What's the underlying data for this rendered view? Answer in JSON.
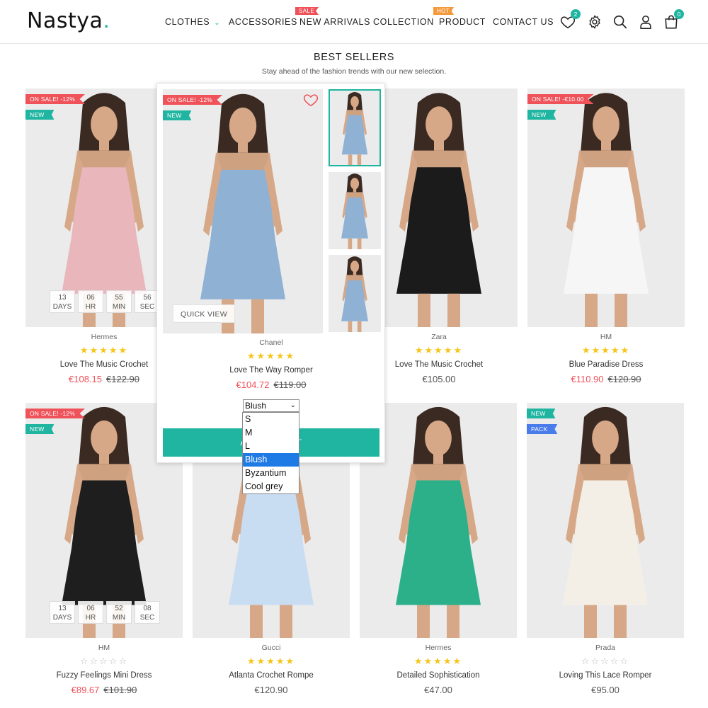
{
  "header": {
    "logo": "Nastya",
    "logo_dot": ".",
    "nav": [
      {
        "label": "CLOTHES",
        "has_chevron": true
      },
      {
        "label": "ACCESSORIES"
      },
      {
        "label": "NEW ARRIVALS",
        "badge": "SALE"
      },
      {
        "label": "COLLECTION"
      },
      {
        "label": "PRODUCT",
        "badge": "HOT"
      },
      {
        "label": "CONTACT US"
      }
    ],
    "wishlist_count": "2",
    "cart_count": "0",
    "icons": [
      "heart-icon",
      "gear-icon",
      "search-icon",
      "user-icon",
      "shopping-bag-icon"
    ]
  },
  "section": {
    "title": "BEST SELLERS",
    "subtitle": "Stay ahead of the fashion trends with our new selection."
  },
  "countdown_units": [
    "DAYS",
    "HR",
    "MIN",
    "SEC"
  ],
  "products": [
    {
      "brand": "Hermes",
      "name": "Love The Music Crochet",
      "price": "€108.15",
      "old_price": "€122.90",
      "rating": 5,
      "badges": [
        "ON SALE! -12%",
        "NEW"
      ],
      "countdown": [
        "13",
        "06",
        "55",
        "56"
      ],
      "color": "#e9b6bb"
    },
    {
      "brand": "Zara",
      "name": "Love The Music Crochet",
      "price": "€105.00",
      "old_price": "",
      "rating": 5,
      "badges": [],
      "color": "#1b1b1b"
    },
    {
      "brand": "HM",
      "name": "Blue Paradise Dress",
      "price": "€110.90",
      "old_price": "€120.90",
      "rating": 5,
      "badges": [
        "ON SALE! -€10.00",
        "NEW"
      ],
      "color": "#f6f6f6"
    },
    {
      "brand": "HM",
      "name": "Fuzzy Feelings Mini Dress",
      "price": "€89.67",
      "old_price": "€101.90",
      "rating": 0,
      "badges": [
        "ON SALE! -12%",
        "NEW"
      ],
      "countdown": [
        "13",
        "06",
        "52",
        "08"
      ],
      "color": "#1e1e1e"
    },
    {
      "brand": "Gucci",
      "name": "Atlanta Crochet Rompe",
      "price": "€120.90",
      "old_price": "",
      "rating": 5,
      "badges": [],
      "color": "#c8dcf2"
    },
    {
      "brand": "Hermes",
      "name": "Detailed Sophistication",
      "price": "€47.00",
      "old_price": "",
      "rating": 5,
      "badges": [],
      "color": "#2bb08a"
    },
    {
      "brand": "Prada",
      "name": "Loving This Lace Romper",
      "price": "€95.00",
      "old_price": "",
      "rating": 0,
      "badges": [
        "NEW",
        "PACK"
      ],
      "color": "#f4efe6"
    }
  ],
  "hover_product": {
    "brand": "Chanel",
    "name": "Love The Way Romper",
    "price": "€104.72",
    "old_price": "€119.00",
    "rating": 5,
    "badges": [
      "ON SALE! -12%",
      "NEW"
    ],
    "quick_view": "QUICK VIEW",
    "add_to_cart": "ADD TO CART",
    "selected_color": "Blush",
    "options": [
      "S",
      "M",
      "L",
      "Blush",
      "Byzantium",
      "Cool grey"
    ],
    "highlighted_option": "Blush",
    "color": "#8fb1d4"
  }
}
